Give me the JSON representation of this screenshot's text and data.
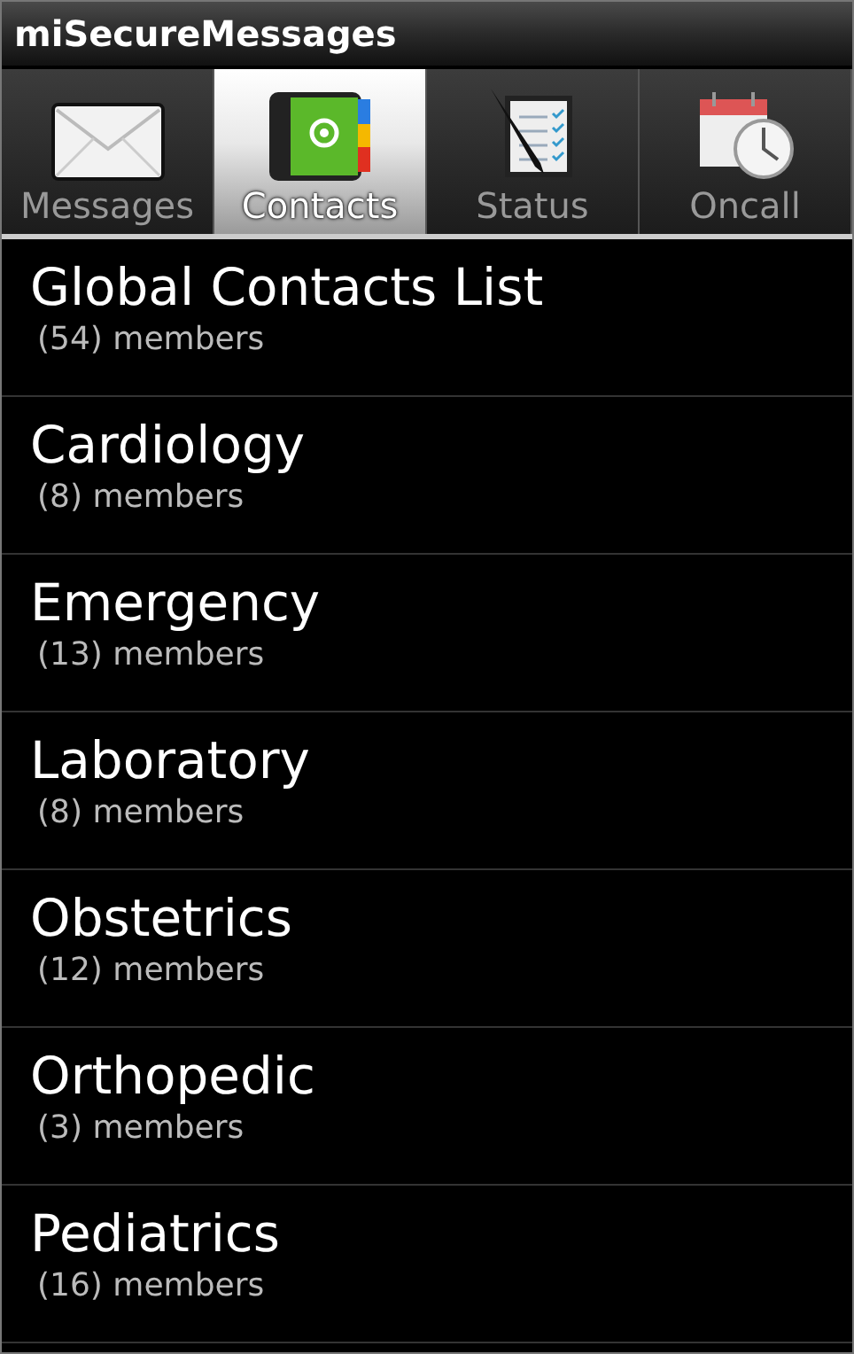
{
  "window": {
    "title": "miSecureMessages"
  },
  "tabs": [
    {
      "label": "Messages",
      "selected": false
    },
    {
      "label": "Contacts",
      "selected": true
    },
    {
      "label": "Status",
      "selected": false
    },
    {
      "label": "Oncall",
      "selected": false
    }
  ],
  "groups": [
    {
      "name": "Global Contacts List",
      "members": "(54) members"
    },
    {
      "name": "Cardiology",
      "members": "(8) members"
    },
    {
      "name": "Emergency",
      "members": "(13) members"
    },
    {
      "name": "Laboratory",
      "members": "(8) members"
    },
    {
      "name": "Obstetrics",
      "members": "(12) members"
    },
    {
      "name": "Orthopedic",
      "members": "(3) members"
    },
    {
      "name": "Pediatrics",
      "members": "(16) members"
    }
  ]
}
